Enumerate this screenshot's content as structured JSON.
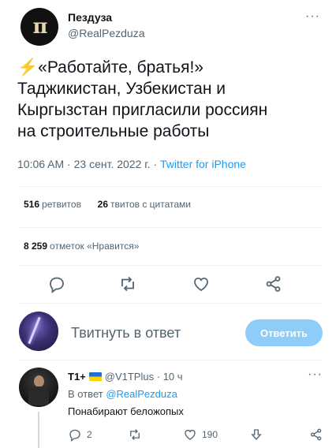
{
  "tweet": {
    "author_name": "Пездуза",
    "author_handle": "@RealPezduza",
    "avatar_text": "п",
    "more_label": "···",
    "text_emoji": "⚡",
    "text_lines": [
      "«Работайте, братья!»",
      "Таджикистан, Узбекистан и",
      "Кыргызстан пригласили россиян",
      "на строительные работы"
    ],
    "time": "10:06 AM",
    "date": "23 сент. 2022 г.",
    "source": "Twitter for iPhone",
    "separator": "·"
  },
  "stats": {
    "retweets_count": "516",
    "retweets_label": "ретвитов",
    "quotes_count": "26",
    "quotes_label": "твитов с цитатами",
    "likes_count": "8 259",
    "likes_label": "отметок «Нравится»"
  },
  "compose": {
    "placeholder": "Твитнуть в ответ",
    "reply_button": "Ответить"
  },
  "reply": {
    "name": "T1+",
    "handle": "@V1TPlus",
    "separator": "·",
    "time": "10 ч",
    "more_label": "···",
    "reply_to_prefix": "В ответ",
    "reply_to_handle": "@RealPezduza",
    "text": "Понабирают беложопых",
    "reply_count": "2",
    "like_count": "190"
  },
  "colors": {
    "accent": "#1d9bf0",
    "muted": "#536471",
    "reply_button_bg": "#8ecdf8"
  }
}
